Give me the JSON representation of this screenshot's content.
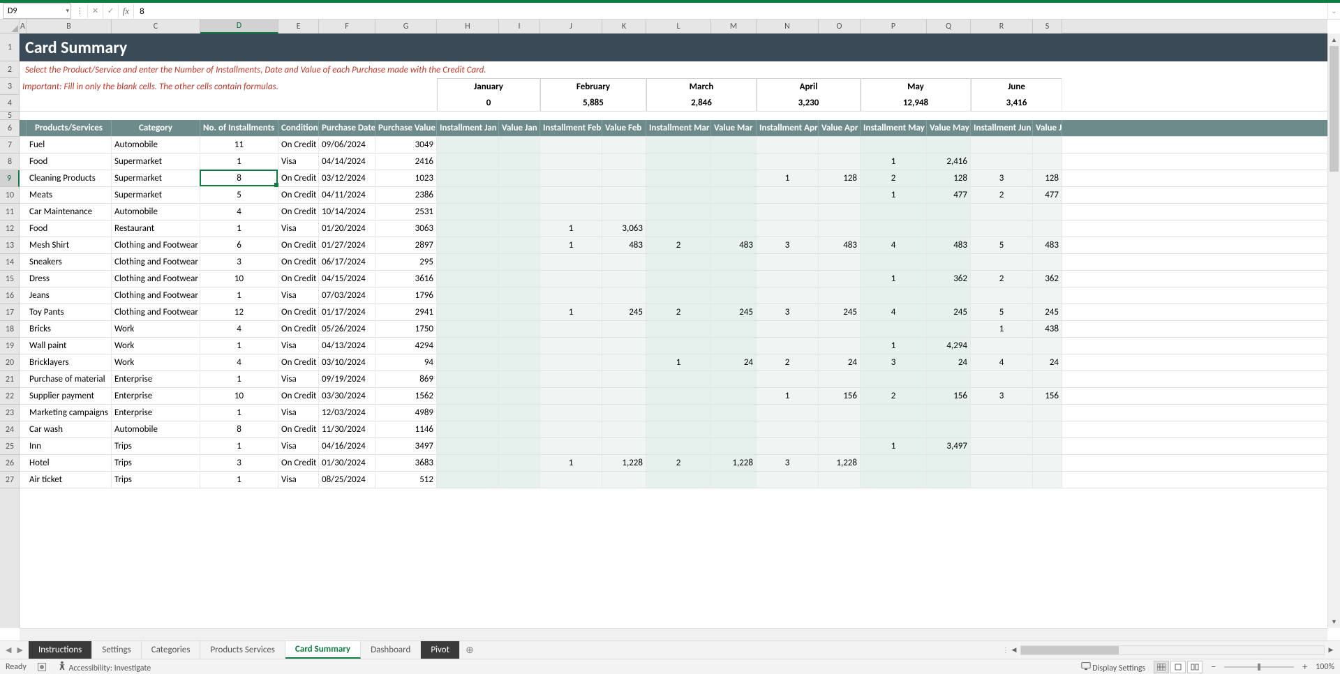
{
  "nameBox": "D9",
  "formulaValue": "8",
  "title": "Card Summary",
  "instr1": "Select the Product/Service and enter the Number of Installments, Date and Value of each Purchase made with the Credit Card.",
  "instr2": "Important: Fill in only the blank cells. The other cells contain formulas.",
  "months": [
    "January",
    "February",
    "March",
    "April",
    "May",
    "June"
  ],
  "monthTotals": [
    "0",
    "5,885",
    "2,846",
    "3,230",
    "12,948",
    "3,416"
  ],
  "columns": [
    "A",
    "B",
    "C",
    "D",
    "E",
    "F",
    "G",
    "H",
    "I",
    "J",
    "K",
    "L",
    "M",
    "N",
    "O",
    "P",
    "Q",
    "R",
    "S"
  ],
  "colWidths": {
    "A": 10,
    "B": 122,
    "C": 127,
    "D": 112,
    "E": 58,
    "F": 81,
    "G": 88,
    "H": 89,
    "I": 59,
    "J": 89,
    "K": 63,
    "L": 93,
    "M": 65,
    "N": 89,
    "O": 60,
    "P": 95,
    "Q": 63,
    "R": 89,
    "S": 42
  },
  "headers": {
    "prod": "Products/Services",
    "cat": "Category",
    "inst": "No. of Installments",
    "cond": "Condition",
    "pdate": "Purchase Date",
    "pval": "Purchase Value",
    "ijan": "Installment Jan",
    "vjan": "Value  Jan",
    "ifeb": "Installment Feb",
    "vfeb": "Value  Feb",
    "imar": "Installment Mar",
    "vmar": "Value  Mar",
    "iapr": "Installment Apr",
    "vapr": "Value  Apr",
    "imay": "Installment May",
    "vmay": "Value  May",
    "ijun": "Installment Jun",
    "vjun": "Value  J"
  },
  "rows": [
    {
      "n": 7,
      "p": "Fuel",
      "c": "Automobile",
      "i": "11",
      "cd": "On Credit",
      "d": "09/06/2024",
      "v": "3049"
    },
    {
      "n": 8,
      "p": "Food",
      "c": "Supermarket",
      "i": "1",
      "cd": "Visa",
      "d": "04/14/2024",
      "v": "2416",
      "imay": "1",
      "vmay": "2,416"
    },
    {
      "n": 9,
      "p": "Cleaning Products",
      "c": "Supermarket",
      "i": "8",
      "cd": "On Credit",
      "d": "03/12/2024",
      "v": "1023",
      "iapr": "1",
      "vapr": "128",
      "imay": "2",
      "vmay": "128",
      "ijun": "3",
      "vjun": "128"
    },
    {
      "n": 10,
      "p": "Meats",
      "c": "Supermarket",
      "i": "5",
      "cd": "On Credit",
      "d": "04/11/2024",
      "v": "2386",
      "imay": "1",
      "vmay": "477",
      "ijun": "2",
      "vjun": "477"
    },
    {
      "n": 11,
      "p": "Car Maintenance",
      "c": "Automobile",
      "i": "4",
      "cd": "On Credit",
      "d": "10/14/2024",
      "v": "2531"
    },
    {
      "n": 12,
      "p": "Food",
      "c": "Restaurant",
      "i": "1",
      "cd": "Visa",
      "d": "01/20/2024",
      "v": "3063",
      "ifeb": "1",
      "vfeb": "3,063"
    },
    {
      "n": 13,
      "p": "Mesh Shirt",
      "c": "Clothing and Footwear",
      "i": "6",
      "cd": "On Credit",
      "d": "01/27/2024",
      "v": "2897",
      "ifeb": "1",
      "vfeb": "483",
      "imar": "2",
      "vmar": "483",
      "iapr": "3",
      "vapr": "483",
      "imay": "4",
      "vmay": "483",
      "ijun": "5",
      "vjun": "483"
    },
    {
      "n": 14,
      "p": "Sneakers",
      "c": "Clothing and Footwear",
      "i": "3",
      "cd": "On Credit",
      "d": "06/17/2024",
      "v": "295"
    },
    {
      "n": 15,
      "p": "Dress",
      "c": "Clothing and Footwear",
      "i": "10",
      "cd": "On Credit",
      "d": "04/15/2024",
      "v": "3616",
      "imay": "1",
      "vmay": "362",
      "ijun": "2",
      "vjun": "362"
    },
    {
      "n": 16,
      "p": "Jeans",
      "c": "Clothing and Footwear",
      "i": "1",
      "cd": "Visa",
      "d": "07/03/2024",
      "v": "1796"
    },
    {
      "n": 17,
      "p": "Toy Pants",
      "c": "Clothing and Footwear",
      "i": "12",
      "cd": "On Credit",
      "d": "01/17/2024",
      "v": "2941",
      "ifeb": "1",
      "vfeb": "245",
      "imar": "2",
      "vmar": "245",
      "iapr": "3",
      "vapr": "245",
      "imay": "4",
      "vmay": "245",
      "ijun": "5",
      "vjun": "245"
    },
    {
      "n": 18,
      "p": "Bricks",
      "c": "Work",
      "i": "4",
      "cd": "On Credit",
      "d": "05/26/2024",
      "v": "1750",
      "ijun": "1",
      "vjun": "438"
    },
    {
      "n": 19,
      "p": "Wall paint",
      "c": "Work",
      "i": "1",
      "cd": "Visa",
      "d": "04/13/2024",
      "v": "4294",
      "imay": "1",
      "vmay": "4,294"
    },
    {
      "n": 20,
      "p": "Bricklayers",
      "c": "Work",
      "i": "4",
      "cd": "On Credit",
      "d": "03/10/2024",
      "v": "94",
      "imar": "1",
      "vmar": "24",
      "iapr": "2",
      "vapr": "24",
      "imay": "3",
      "vmay": "24",
      "ijun": "4",
      "vjun": "24"
    },
    {
      "n": 21,
      "p": "Purchase of material",
      "c": "Enterprise",
      "i": "1",
      "cd": "Visa",
      "d": "09/19/2024",
      "v": "869"
    },
    {
      "n": 22,
      "p": "Supplier payment",
      "c": "Enterprise",
      "i": "10",
      "cd": "On Credit",
      "d": "03/30/2024",
      "v": "1562",
      "iapr": "1",
      "vapr": "156",
      "imay": "2",
      "vmay": "156",
      "ijun": "3",
      "vjun": "156"
    },
    {
      "n": 23,
      "p": "Marketing campaigns",
      "c": "Enterprise",
      "i": "1",
      "cd": "Visa",
      "d": "12/03/2024",
      "v": "4989"
    },
    {
      "n": 24,
      "p": "Car wash",
      "c": "Automobile",
      "i": "8",
      "cd": "On Credit",
      "d": "11/30/2024",
      "v": "1146"
    },
    {
      "n": 25,
      "p": "Inn",
      "c": "Trips",
      "i": "1",
      "cd": "Visa",
      "d": "04/16/2024",
      "v": "3497",
      "imay": "1",
      "vmay": "3,497"
    },
    {
      "n": 26,
      "p": "Hotel",
      "c": "Trips",
      "i": "3",
      "cd": "On Credit",
      "d": "01/30/2024",
      "v": "3683",
      "ifeb": "1",
      "vfeb": "1,228",
      "imar": "2",
      "vmar": "1,228",
      "iapr": "3",
      "vapr": "1,228"
    },
    {
      "n": 27,
      "p": "Air ticket",
      "c": "Trips",
      "i": "1",
      "cd": "Visa",
      "d": "08/25/2024",
      "v": "512"
    }
  ],
  "rowNumbers": [
    1,
    2,
    3,
    4,
    5,
    6,
    7,
    8,
    9,
    10,
    11,
    12,
    13,
    14,
    15,
    16,
    17,
    18,
    19,
    20,
    21,
    22,
    23,
    24,
    25,
    26,
    27
  ],
  "rowHeights": {
    "1": 40,
    "2": 24,
    "3": 24,
    "4": 24,
    "5": 12,
    "6": 24
  },
  "tabs": [
    {
      "label": "Instructions",
      "style": "dark"
    },
    {
      "label": "Settings",
      "style": "plain"
    },
    {
      "label": "Categories",
      "style": "plain"
    },
    {
      "label": "Products Services",
      "style": "plain"
    },
    {
      "label": "Card Summary",
      "style": "active"
    },
    {
      "label": "Dashboard",
      "style": "plain"
    },
    {
      "label": "Pivot",
      "style": "dark"
    }
  ],
  "status": {
    "ready": "Ready",
    "accessibility": "Accessibility: Investigate",
    "display": "Display Settings",
    "zoom": "100%"
  }
}
